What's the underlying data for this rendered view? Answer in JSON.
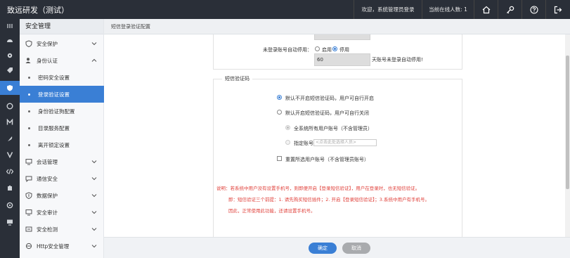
{
  "app": {
    "title": "致远研发（测试）"
  },
  "header": {
    "welcome": "欢迎，系统管理员登录",
    "online": "当前在线人数: 1",
    "buttons": [
      "home-icon",
      "key-icon",
      "help-icon",
      "logout-icon"
    ]
  },
  "rail": {
    "icons": [
      "menu-icon",
      "dashboard-icon",
      "gear-icon",
      "tag-icon",
      "shield-icon",
      "circle-icon",
      "m-icon",
      "feather-icon",
      "v-icon",
      "code-icon",
      "puzzle-icon",
      "settings-icon",
      "monitor-icon"
    ],
    "active_index": 4
  },
  "sidebar": {
    "title": "安全管理",
    "items": [
      {
        "label": "安全保护",
        "icon": "shield-icon"
      },
      {
        "label": "身份认证",
        "icon": "user-icon",
        "expanded": true
      },
      {
        "label": "会话管理",
        "icon": "monitor-icon"
      },
      {
        "label": "通信安全",
        "icon": "comm-icon"
      },
      {
        "label": "数据保护",
        "icon": "data-icon"
      },
      {
        "label": "安全审计",
        "icon": "audit-icon"
      },
      {
        "label": "安全检测",
        "icon": "detect-icon"
      },
      {
        "label": "Http安全管理",
        "icon": "http-icon"
      }
    ],
    "subitems": [
      {
        "label": "密码安全设置"
      },
      {
        "label": "登录验证设置",
        "active": true
      },
      {
        "label": "身份验证狗配置"
      },
      {
        "label": "目录服务配置"
      },
      {
        "label": "离开锁定设置"
      }
    ]
  },
  "breadcrumb": "短信登录验证配置",
  "form": {
    "auto_disable_label": "未登录账号自动停用：",
    "opt_enable": "启用",
    "opt_disable": "停用",
    "days_value": "60",
    "days_suffix": "天账号未登录自动停用!",
    "sms_section_title": "短信验证码",
    "sms_opt1": "默认不开启短信验证码，用户可自行开启",
    "sms_opt2": "默认开启短信验证码，用户可自行关闭",
    "sub_opt1": "全系统所有用户账号（不含管理员）",
    "sub_opt2": "指定账号",
    "pick_placeholder": "<点击此处选择人员>",
    "reset_label": "重置所选用户账号（不含管理员账号）",
    "note_line1": "说明：若系统中用户没有设置手机号，则即便开启【登录短信验证】，用户在登录时，也无短信验证。",
    "note_line2": "即：短信验证三个前提：1. 请先购买短信插件；2. 开启【登录短信验证】；3.系统中用户有手机号。",
    "note_line3": "因此，正常使用此功能，还请设置手机号。"
  },
  "footer": {
    "ok": "确定",
    "cancel": "取消"
  },
  "colors": {
    "accent": "#3a7fd5",
    "topbar": "#2a2f38",
    "note": "#e0413b"
  }
}
